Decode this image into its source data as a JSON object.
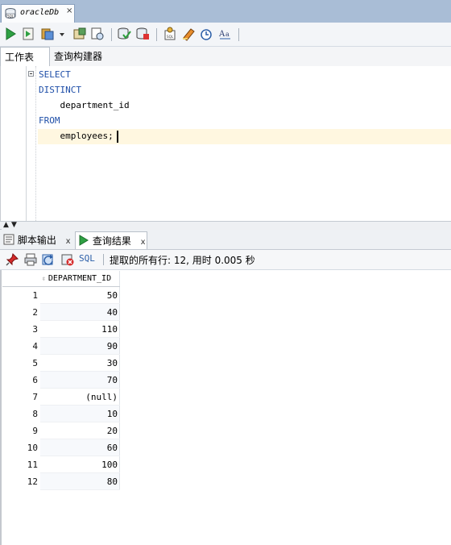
{
  "document_tab": {
    "title": "oracleDb",
    "close": "×"
  },
  "toolbar": {
    "icons": [
      "run-statement-icon",
      "run-script-icon",
      "autotrace-icon",
      "dropdown-icon",
      "explain-plan-icon",
      "sql-tuning-icon",
      "commit-icon",
      "rollback-icon",
      "unshared-worksheet-icon",
      "clear-icon",
      "sql-history-icon",
      "format-case-icon"
    ]
  },
  "subtabs": {
    "worksheet": "工作表",
    "query_builder": "查询构建器"
  },
  "editor": {
    "lines": [
      "SELECT",
      "DISTINCT",
      "    department_id",
      "FROM",
      "    employees;"
    ]
  },
  "result_tabs": {
    "script_output": "脚本输出",
    "query_result": "查询结果",
    "close": "x"
  },
  "result_toolbar": {
    "sql_label": "SQL",
    "status": "提取的所有行: 12, 用时 0.005 秒"
  },
  "grid": {
    "column": "DEPARTMENT_ID",
    "rows": [
      {
        "n": "1",
        "v": "50"
      },
      {
        "n": "2",
        "v": "40"
      },
      {
        "n": "3",
        "v": "110"
      },
      {
        "n": "4",
        "v": "90"
      },
      {
        "n": "5",
        "v": "30"
      },
      {
        "n": "6",
        "v": "70"
      },
      {
        "n": "7",
        "v": "(null)"
      },
      {
        "n": "8",
        "v": "10"
      },
      {
        "n": "9",
        "v": "20"
      },
      {
        "n": "10",
        "v": "60"
      },
      {
        "n": "11",
        "v": "100"
      },
      {
        "n": "12",
        "v": "80"
      }
    ]
  },
  "colors": {
    "keyword": "#1f4fa8",
    "tab_strip": "#a9bdd6",
    "current_line": "#fff7e0"
  }
}
